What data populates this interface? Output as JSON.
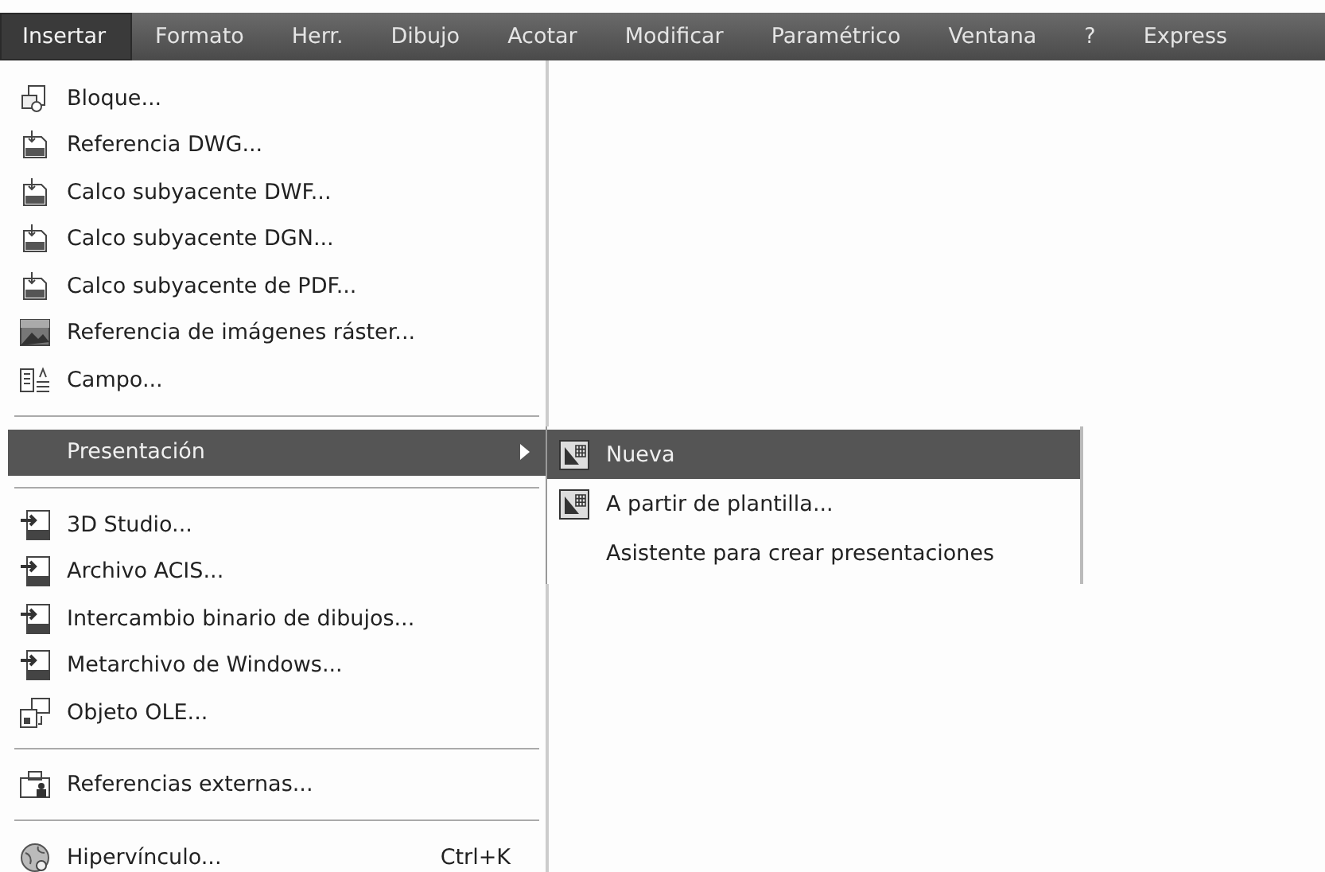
{
  "menubar": [
    {
      "label": "Insertar",
      "selected": true
    },
    {
      "label": "Formato",
      "selected": false
    },
    {
      "label": "Herr.",
      "selected": false
    },
    {
      "label": "Dibujo",
      "selected": false
    },
    {
      "label": "Acotar",
      "selected": false
    },
    {
      "label": "Modificar",
      "selected": false
    },
    {
      "label": "Paramétrico",
      "selected": false
    },
    {
      "label": "Ventana",
      "selected": false
    },
    {
      "label": "?",
      "selected": false
    },
    {
      "label": "Express",
      "selected": false
    }
  ],
  "menu": {
    "groups": [
      [
        {
          "kind": "block",
          "label": "Bloque...",
          "selected": false
        },
        {
          "kind": "file",
          "label": "Referencia DWG...",
          "selected": false
        },
        {
          "kind": "file",
          "label": "Calco subyacente DWF...",
          "selected": false
        },
        {
          "kind": "file",
          "label": "Calco subyacente DGN...",
          "selected": false
        },
        {
          "kind": "file",
          "label": "Calco subyacente de PDF...",
          "selected": false
        },
        {
          "kind": "image",
          "label": "Referencia de imágenes ráster...",
          "selected": false
        },
        {
          "kind": "field",
          "label": "Campo...",
          "selected": false
        }
      ],
      [
        {
          "kind": "submenu",
          "label": "Presentación",
          "selected": true
        }
      ],
      [
        {
          "kind": "import",
          "label": "3D Studio...",
          "selected": false
        },
        {
          "kind": "import",
          "label": "Archivo ACIS...",
          "selected": false
        },
        {
          "kind": "import",
          "label": "Intercambio binario de dibujos...",
          "selected": false
        },
        {
          "kind": "import",
          "label": "Metarchivo de Windows...",
          "selected": false
        },
        {
          "kind": "ole",
          "label": "Objeto OLE...",
          "selected": false
        }
      ],
      [
        {
          "kind": "xref",
          "label": "Referencias externas...",
          "selected": false
        }
      ],
      [
        {
          "kind": "link",
          "label": "Hipervínculo...",
          "shortcut": "Ctrl+K",
          "selected": false
        }
      ]
    ]
  },
  "submenu": {
    "items": [
      {
        "kind": "layout",
        "label": "Nueva",
        "selected": true
      },
      {
        "kind": "layout",
        "label": "A partir de plantilla...",
        "selected": false
      },
      {
        "kind": "plain",
        "label": "Asistente para crear presentaciones",
        "selected": false
      }
    ]
  }
}
